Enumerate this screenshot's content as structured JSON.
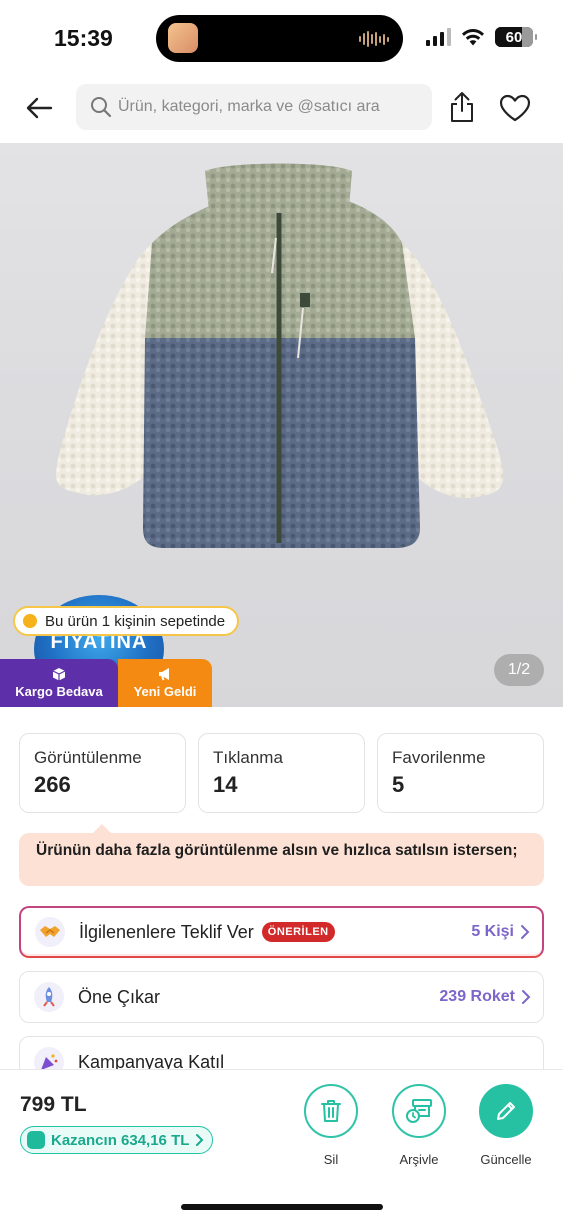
{
  "status_bar": {
    "time": "15:39",
    "battery": "60"
  },
  "header": {
    "search_placeholder": "Ürün, kategori, marka ve @satıcı ara"
  },
  "product": {
    "cart_notice": "Bu ürün 1 kişinin sepetinde",
    "promo_badge_text": "FIYATINA",
    "tags": {
      "kargo": "Kargo Bedava",
      "yeni": "Yeni Geldi"
    },
    "page_indicator": "1/2"
  },
  "stats": [
    {
      "label": "Görüntülenme",
      "value": "266"
    },
    {
      "label": "Tıklanma",
      "value": "14"
    },
    {
      "label": "Favorilenme",
      "value": "5"
    }
  ],
  "tip": {
    "text": "Ürünün daha fazla görüntülenme alsın ve hızlıca satılsın istersen;"
  },
  "actions": [
    {
      "label": "İlgilenenlere Teklif Ver",
      "badge": "ÖNERİLEN",
      "value": "5 Kişi",
      "icon": "handshake-icon"
    },
    {
      "label": "Öne Çıkar",
      "value": "239 Roket",
      "icon": "rocket-icon"
    },
    {
      "label": "Kampanyaya Katıl",
      "icon": "party-icon"
    }
  ],
  "bottom": {
    "price": "799 TL",
    "gain": "Kazancın 634,16 TL",
    "delete_label": "Sil",
    "archive_label": "Arşivle",
    "update_label": "Güncelle"
  },
  "colors": {
    "accent_teal": "#26c1a2",
    "purple": "#5d2fa8",
    "orange": "#f58a12",
    "badge_red": "#d22a2a",
    "tip_bg": "#fde1d4"
  }
}
